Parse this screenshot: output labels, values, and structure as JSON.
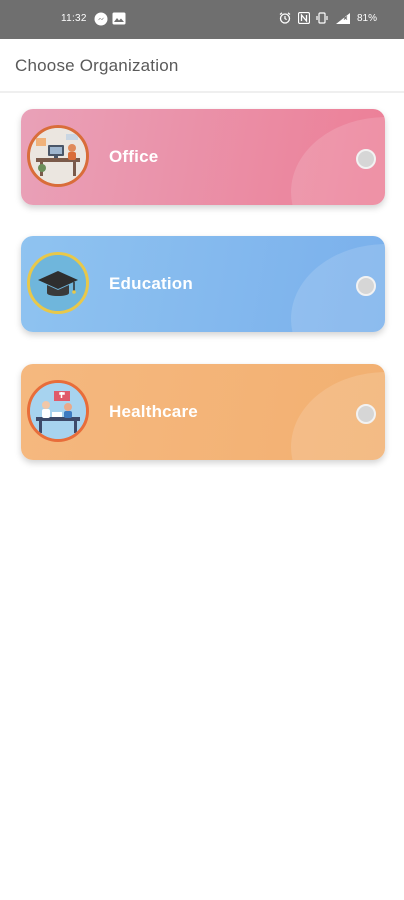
{
  "status_bar": {
    "time": "11:32",
    "battery": "81%",
    "icons": [
      "messenger-icon",
      "gallery-icon",
      "alarm-icon",
      "nfc-icon",
      "vibrate-icon",
      "signal-icon"
    ]
  },
  "app_bar": {
    "title": "Choose Organization"
  },
  "organizations": [
    {
      "label": "Office",
      "icon": "office-illustration-icon",
      "selected": false,
      "colors": {
        "from": "#e9a1b8",
        "to": "#ec7f97",
        "accent": "#d96d3a"
      }
    },
    {
      "label": "Education",
      "icon": "graduation-cap-icon",
      "selected": false,
      "colors": {
        "from": "#8fc3f0",
        "to": "#7ab0ec",
        "accent": "#e8c84a"
      }
    },
    {
      "label": "Healthcare",
      "icon": "healthcare-illustration-icon",
      "selected": false,
      "colors": {
        "from": "#f5b87f",
        "to": "#f2b071",
        "accent": "#e86d3a"
      }
    }
  ]
}
